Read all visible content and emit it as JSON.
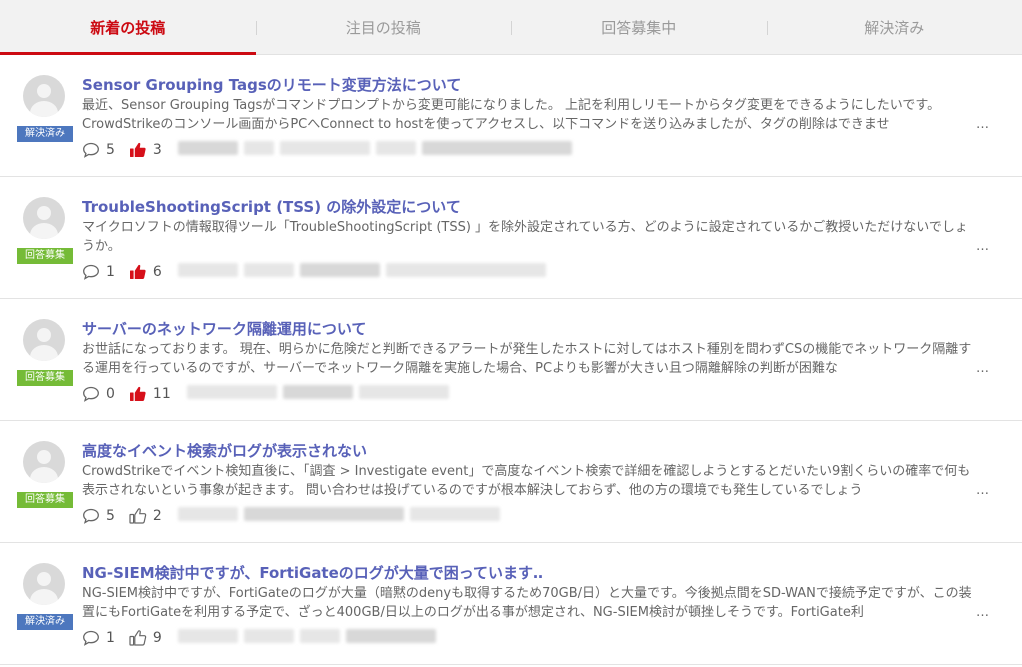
{
  "tabs": [
    {
      "label": "新着の投稿",
      "active": true
    },
    {
      "label": "注目の投稿",
      "active": false
    },
    {
      "label": "回答募集中",
      "active": false
    },
    {
      "label": "解決済み",
      "active": false
    }
  ],
  "colors": {
    "accent": "#cc0a12",
    "title": "#5861b8",
    "badge_resolved": "#4d77be",
    "badge_open": "#75bb37",
    "like_active": "#d6101a",
    "like_inactive": "#666666"
  },
  "icons": {
    "avatar": "user-avatar-icon",
    "comment": "speech-bubble-icon",
    "like": "thumbs-up-icon"
  },
  "ellipsis": "…",
  "posts": [
    {
      "title": "Sensor Grouping Tagsのリモート変更方法について",
      "excerpt": "最近、Sensor Grouping Tagsがコマンドプロンプトから変更可能になりました。 上記を利用しリモートからタグ変更をできるようにしたいです。 CrowdStrikeのコンソール画面からPCへConnect to hostを使ってアクセスし、以下コマンドを送り込みましたが、タグの削除はできませ",
      "badge": "解決済み",
      "badge_type": "resolved",
      "comments": "5",
      "likes": "3",
      "liked": true
    },
    {
      "title": "TroubleShootingScript (TSS) の除外設定について",
      "excerpt": "マイクロソフトの情報取得ツール「TroubleShootingScript (TSS) 」を除外設定されている方、どのように設定されているかご教授いただけないでしょうか。",
      "badge": "回答募集",
      "badge_type": "open",
      "comments": "1",
      "likes": "6",
      "liked": true
    },
    {
      "title": "サーバーのネットワーク隔離運用について",
      "excerpt": "お世話になっております。 現在、明らかに危険だと判断できるアラートが発生したホストに対してはホスト種別を問わずCSの機能でネットワーク隔離する運用を行っているのですが、サーバーでネットワーク隔離を実施した場合、PCよりも影響が大きい且つ隔離解除の判断が困難な",
      "badge": "回答募集",
      "badge_type": "open",
      "comments": "0",
      "likes": "11",
      "liked": true
    },
    {
      "title": "高度なイベント検索がログが表示されない",
      "excerpt": "CrowdStrikeでイベント検知直後に、「調査 > Investigate event」で高度なイベント検索で詳細を確認しようとするとだいたい9割くらいの確率で何も表示されないという事象が起きます。 問い合わせは投げているのですが根本解決しておらず、他の方の環境でも発生しているでしょう",
      "badge": "回答募集",
      "badge_type": "open",
      "comments": "5",
      "likes": "2",
      "liked": false
    },
    {
      "title": "NG-SIEM検討中ですが、FortiGateのログが大量で困っています‥",
      "excerpt": "NG-SIEM検討中ですが、FortiGateのログが大量（暗黙のdenyも取得するため70GB/日）と大量です。今後拠点間をSD-WANで接続予定ですが、この装置にもFortiGateを利用する予定で、ざっと400GB/日以上のログが出る事が想定され、NG-SIEM検討が頓挫しそうです。FortiGate利",
      "badge": "解決済み",
      "badge_type": "resolved",
      "comments": "1",
      "likes": "9",
      "liked": false
    }
  ]
}
